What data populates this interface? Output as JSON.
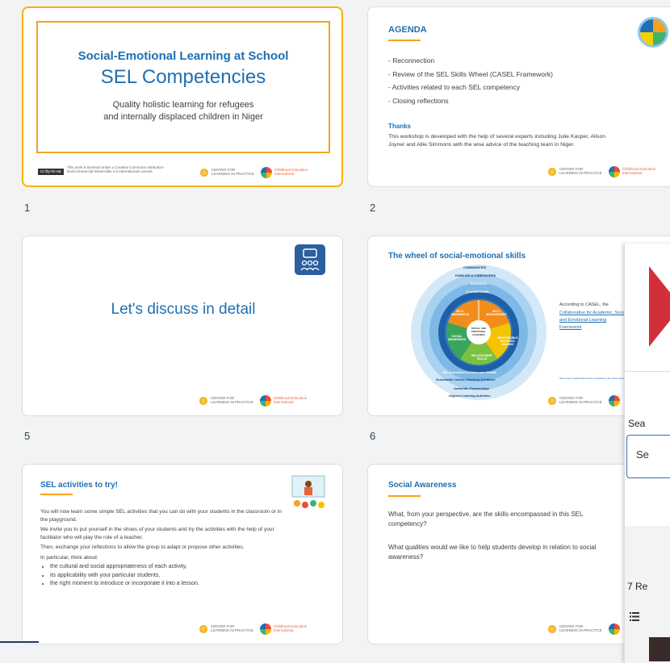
{
  "slides": [
    {
      "number": "1",
      "title_small": "Social-Emotional Learning at School",
      "title_big": "SEL Competencies",
      "subtitle_1": "Quality holistic learning for refugees",
      "subtitle_2": "and internally displaced children in Niger",
      "license_text": "This work is licensed under a Creative Commons Attribution-NonCommercial-ShareAlike 4.0 International License",
      "license_badge": "cc by-nc-sa"
    },
    {
      "number": "2",
      "title": "AGENDA",
      "items": [
        "- Reconnection",
        "- Review of the SEL Skills Wheel (CASEL Framework)",
        "- Activities related to each SEL competency",
        "- Closing reflections"
      ],
      "thanks_title": "Thanks",
      "thanks_text": "This workshop is developed with the help of several experts including Julie Kasper, Alison Joyner and Allie Simmons with the wise advice of the teaching team in Niger."
    },
    {
      "number": "5",
      "title": "Let's discuss in detail"
    },
    {
      "number": "6",
      "title": "The wheel of social-emotional skills",
      "side_text": "According to CASEL, the",
      "side_link": "Collaborative for Academic, Social, and Emotional Learning Framework",
      "url_text": "https://casel.org/fundamentals-of-sel/what-is-the-casel-framework/",
      "ring_labels": [
        "COMMUNITIES",
        "FAMILIES & CAREGIVERS",
        "SCHOOLS",
        "CLASSROOMS"
      ],
      "segments": [
        "SELF-AWARENESS",
        "SELF-MANAGEMENT",
        "RESPONSIBLE DECISION-MAKING",
        "RELATIONSHIP SKILLS",
        "SOCIAL AWARENESS"
      ],
      "center": "SOCIAL AND EMOTIONAL LEARNING",
      "bottom_labels": [
        "SEL Instruction & Classroom Climate",
        "Schoolwide Culture, Practices & Policies",
        "Authentic Partnerships",
        "Aligned Learning Activities"
      ]
    },
    {
      "number": "",
      "title": "SEL activities to try!",
      "p1": "You will now learn some simple SEL activities that you can do with your students in the classroom or in the playground.",
      "p2": "We invite you to put yourself in the shoes of your students and try the activities with the help of your facilitator who will play the role of a teacher.",
      "p3": "Then, exchange your reflections to allow the group to adapt or propose other activities.",
      "p4": "In particular, think about:",
      "bullets": [
        "the cultural and social appropriateness of each activity,",
        "its applicability with your particular students,",
        "the right moment to introduce or incorporate it into a lesson."
      ]
    },
    {
      "number": "",
      "title": "Social Awareness",
      "q1": "What, from your perspective, are the skills encompassed in this SEL competency?",
      "q2": "What qualities would we like to help students develop in relation to social awareness?"
    }
  ],
  "footer": {
    "center_line1": "CENTER FOR",
    "center_line2": "LEARNING IN PRACTICE",
    "cei_line1": "Childhood Education",
    "cei_line2": "International"
  },
  "side_panel": {
    "search_label": "Sea",
    "search_value": "Se",
    "results": "7 Re",
    "list_icon": "list-icon"
  }
}
